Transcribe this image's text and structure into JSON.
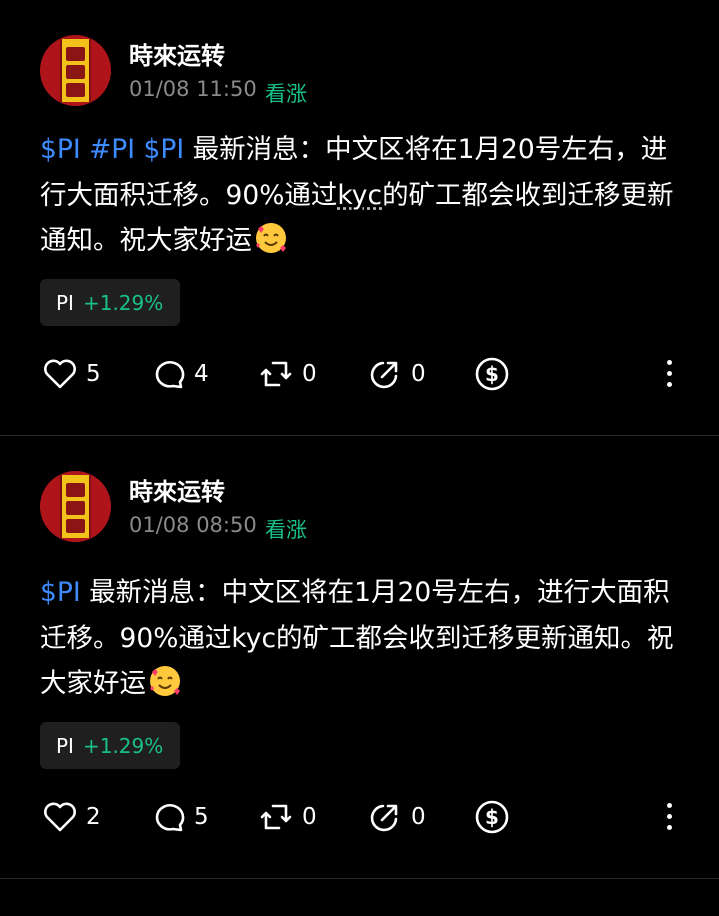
{
  "posts": [
    {
      "author": "時來运转",
      "timestamp": "01/08 11:50",
      "sentiment": "看涨",
      "tags": [
        "$PI",
        "#PI",
        "$PI"
      ],
      "text_before_kyc": "最新消息：中文区将在1月20号左右，进行大面积迁移。90%通过",
      "kyc": "kyc",
      "text_after_kyc": "的矿工都会收到迁移更新通知。祝大家好运",
      "emoji": "smiling-face-with-hearts",
      "ticker": {
        "symbol": "PI",
        "change": "+1.29%"
      },
      "actions": {
        "likes": "5",
        "comments": "4",
        "reposts": "0",
        "shares": "0"
      }
    },
    {
      "author": "時來运转",
      "timestamp": "01/08 08:50",
      "sentiment": "看涨",
      "tags": [
        "$PI"
      ],
      "text": "最新消息：中文区将在1月20号左右，进行大面积迁移。90%通过kyc的矿工都会收到迁移更新通知。祝大家好运",
      "emoji": "smiling-face-with-hearts",
      "ticker": {
        "symbol": "PI",
        "change": "+1.29%"
      },
      "actions": {
        "likes": "2",
        "comments": "5",
        "reposts": "0",
        "shares": "0"
      }
    }
  ],
  "colors": {
    "background": "#000000",
    "accent_tag": "#3d8cff",
    "positive": "#19c08a",
    "muted": "#8a8a8a"
  },
  "icons": [
    "heart-icon",
    "comment-icon",
    "repost-icon",
    "share-icon",
    "tip-dollar-icon",
    "more-vertical-icon",
    "avatar-talisman"
  ]
}
